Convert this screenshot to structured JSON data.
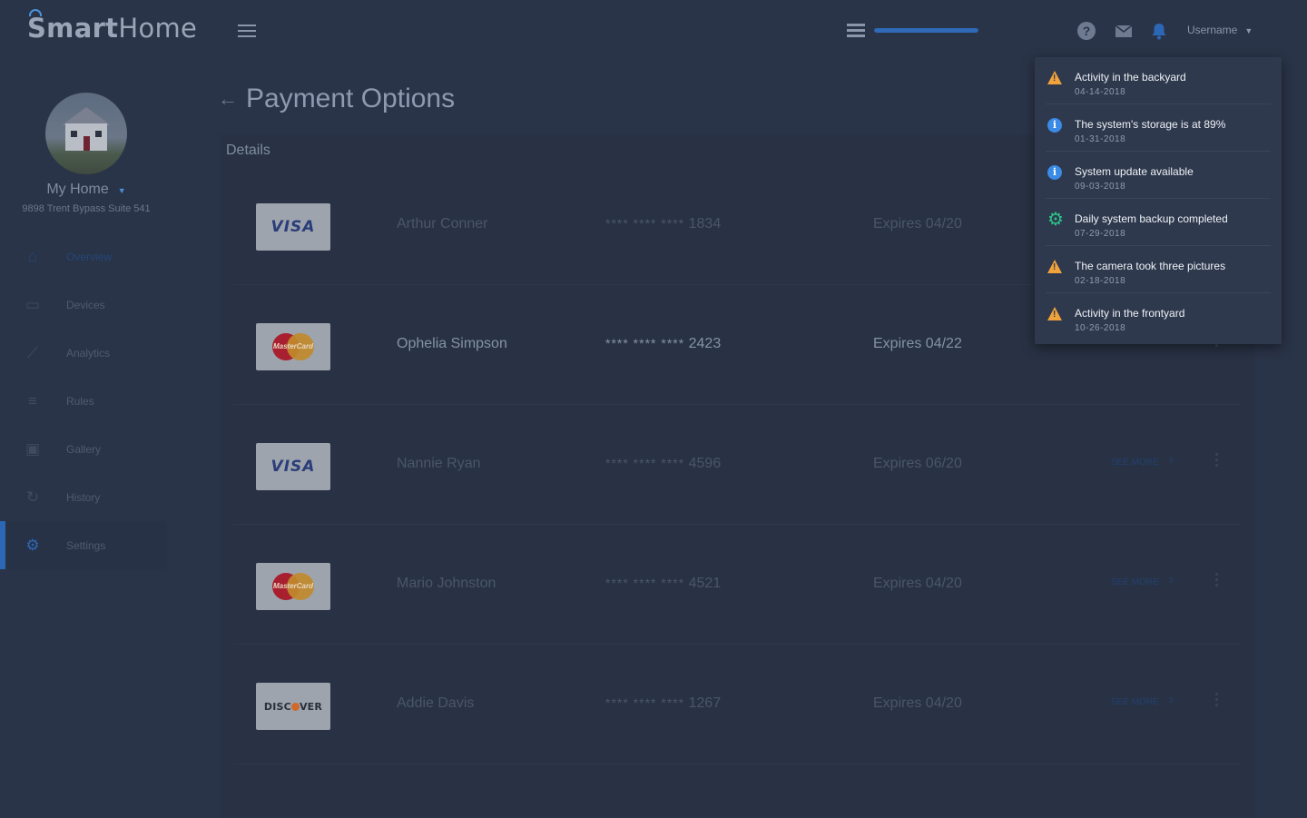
{
  "app": {
    "logo_smart": "Smart",
    "logo_home": "Home"
  },
  "topbar": {
    "username": "Username",
    "progress": 1.0
  },
  "sidebar": {
    "home_name": "My Home",
    "home_address": "9898 Trent Bypass Suite 541",
    "items": [
      {
        "label": "Overview",
        "icon": "home-icon",
        "glyph": "⌂"
      },
      {
        "label": "Devices",
        "icon": "devices-icon",
        "glyph": "▭"
      },
      {
        "label": "Analytics",
        "icon": "analytics-icon",
        "glyph": "⟋"
      },
      {
        "label": "Rules",
        "icon": "rules-icon",
        "glyph": "≡"
      },
      {
        "label": "Gallery",
        "icon": "gallery-icon",
        "glyph": "▣"
      },
      {
        "label": "History",
        "icon": "history-icon",
        "glyph": "↻"
      },
      {
        "label": "Settings",
        "icon": "gear-icon",
        "glyph": "⚙"
      }
    ]
  },
  "main": {
    "title": "Payment Options",
    "details_label": "Details",
    "see_more": "SEE MORE",
    "masked_prefix": "**** **** ****",
    "cards": [
      {
        "brand": "VISA",
        "name": "Arthur Conner",
        "last4": "1834",
        "expires": "Expires 04/20"
      },
      {
        "brand": "MasterCard",
        "name": "Ophelia Simpson",
        "last4": "2423",
        "expires": "Expires 04/22"
      },
      {
        "brand": "VISA",
        "name": "Nannie Ryan",
        "last4": "4596",
        "expires": "Expires 06/20"
      },
      {
        "brand": "MasterCard",
        "name": "Mario Johnston",
        "last4": "4521",
        "expires": "Expires 04/20"
      },
      {
        "brand": "DISCOVER",
        "name": "Addie Davis",
        "last4": "1267",
        "expires": "Expires 04/20"
      }
    ]
  },
  "notifications": [
    {
      "type": "warning",
      "icon": "warning-icon",
      "title": "Activity in the backyard",
      "date": "04-14-2018",
      "color": "#f0a23b"
    },
    {
      "type": "info",
      "icon": "info-icon",
      "title": "The system's storage is at 89%",
      "date": "01-31-2018",
      "color": "#3a8ae6"
    },
    {
      "type": "info",
      "icon": "info-icon",
      "title": "System update available",
      "date": "09-03-2018",
      "color": "#3a8ae6"
    },
    {
      "type": "success",
      "icon": "gear-icon",
      "title": "Daily system backup completed",
      "date": "07-29-2018",
      "color": "#2bc48a"
    },
    {
      "type": "warning",
      "icon": "warning-icon",
      "title": "The camera took three pictures",
      "date": "02-18-2018",
      "color": "#f0a23b"
    },
    {
      "type": "warning",
      "icon": "warning-icon",
      "title": "Activity in the frontyard",
      "date": "10-26-2018",
      "color": "#f0a23b"
    }
  ],
  "colors": {
    "accent": "#2c67b5",
    "background": "#2a3448",
    "panel": "#283244"
  }
}
